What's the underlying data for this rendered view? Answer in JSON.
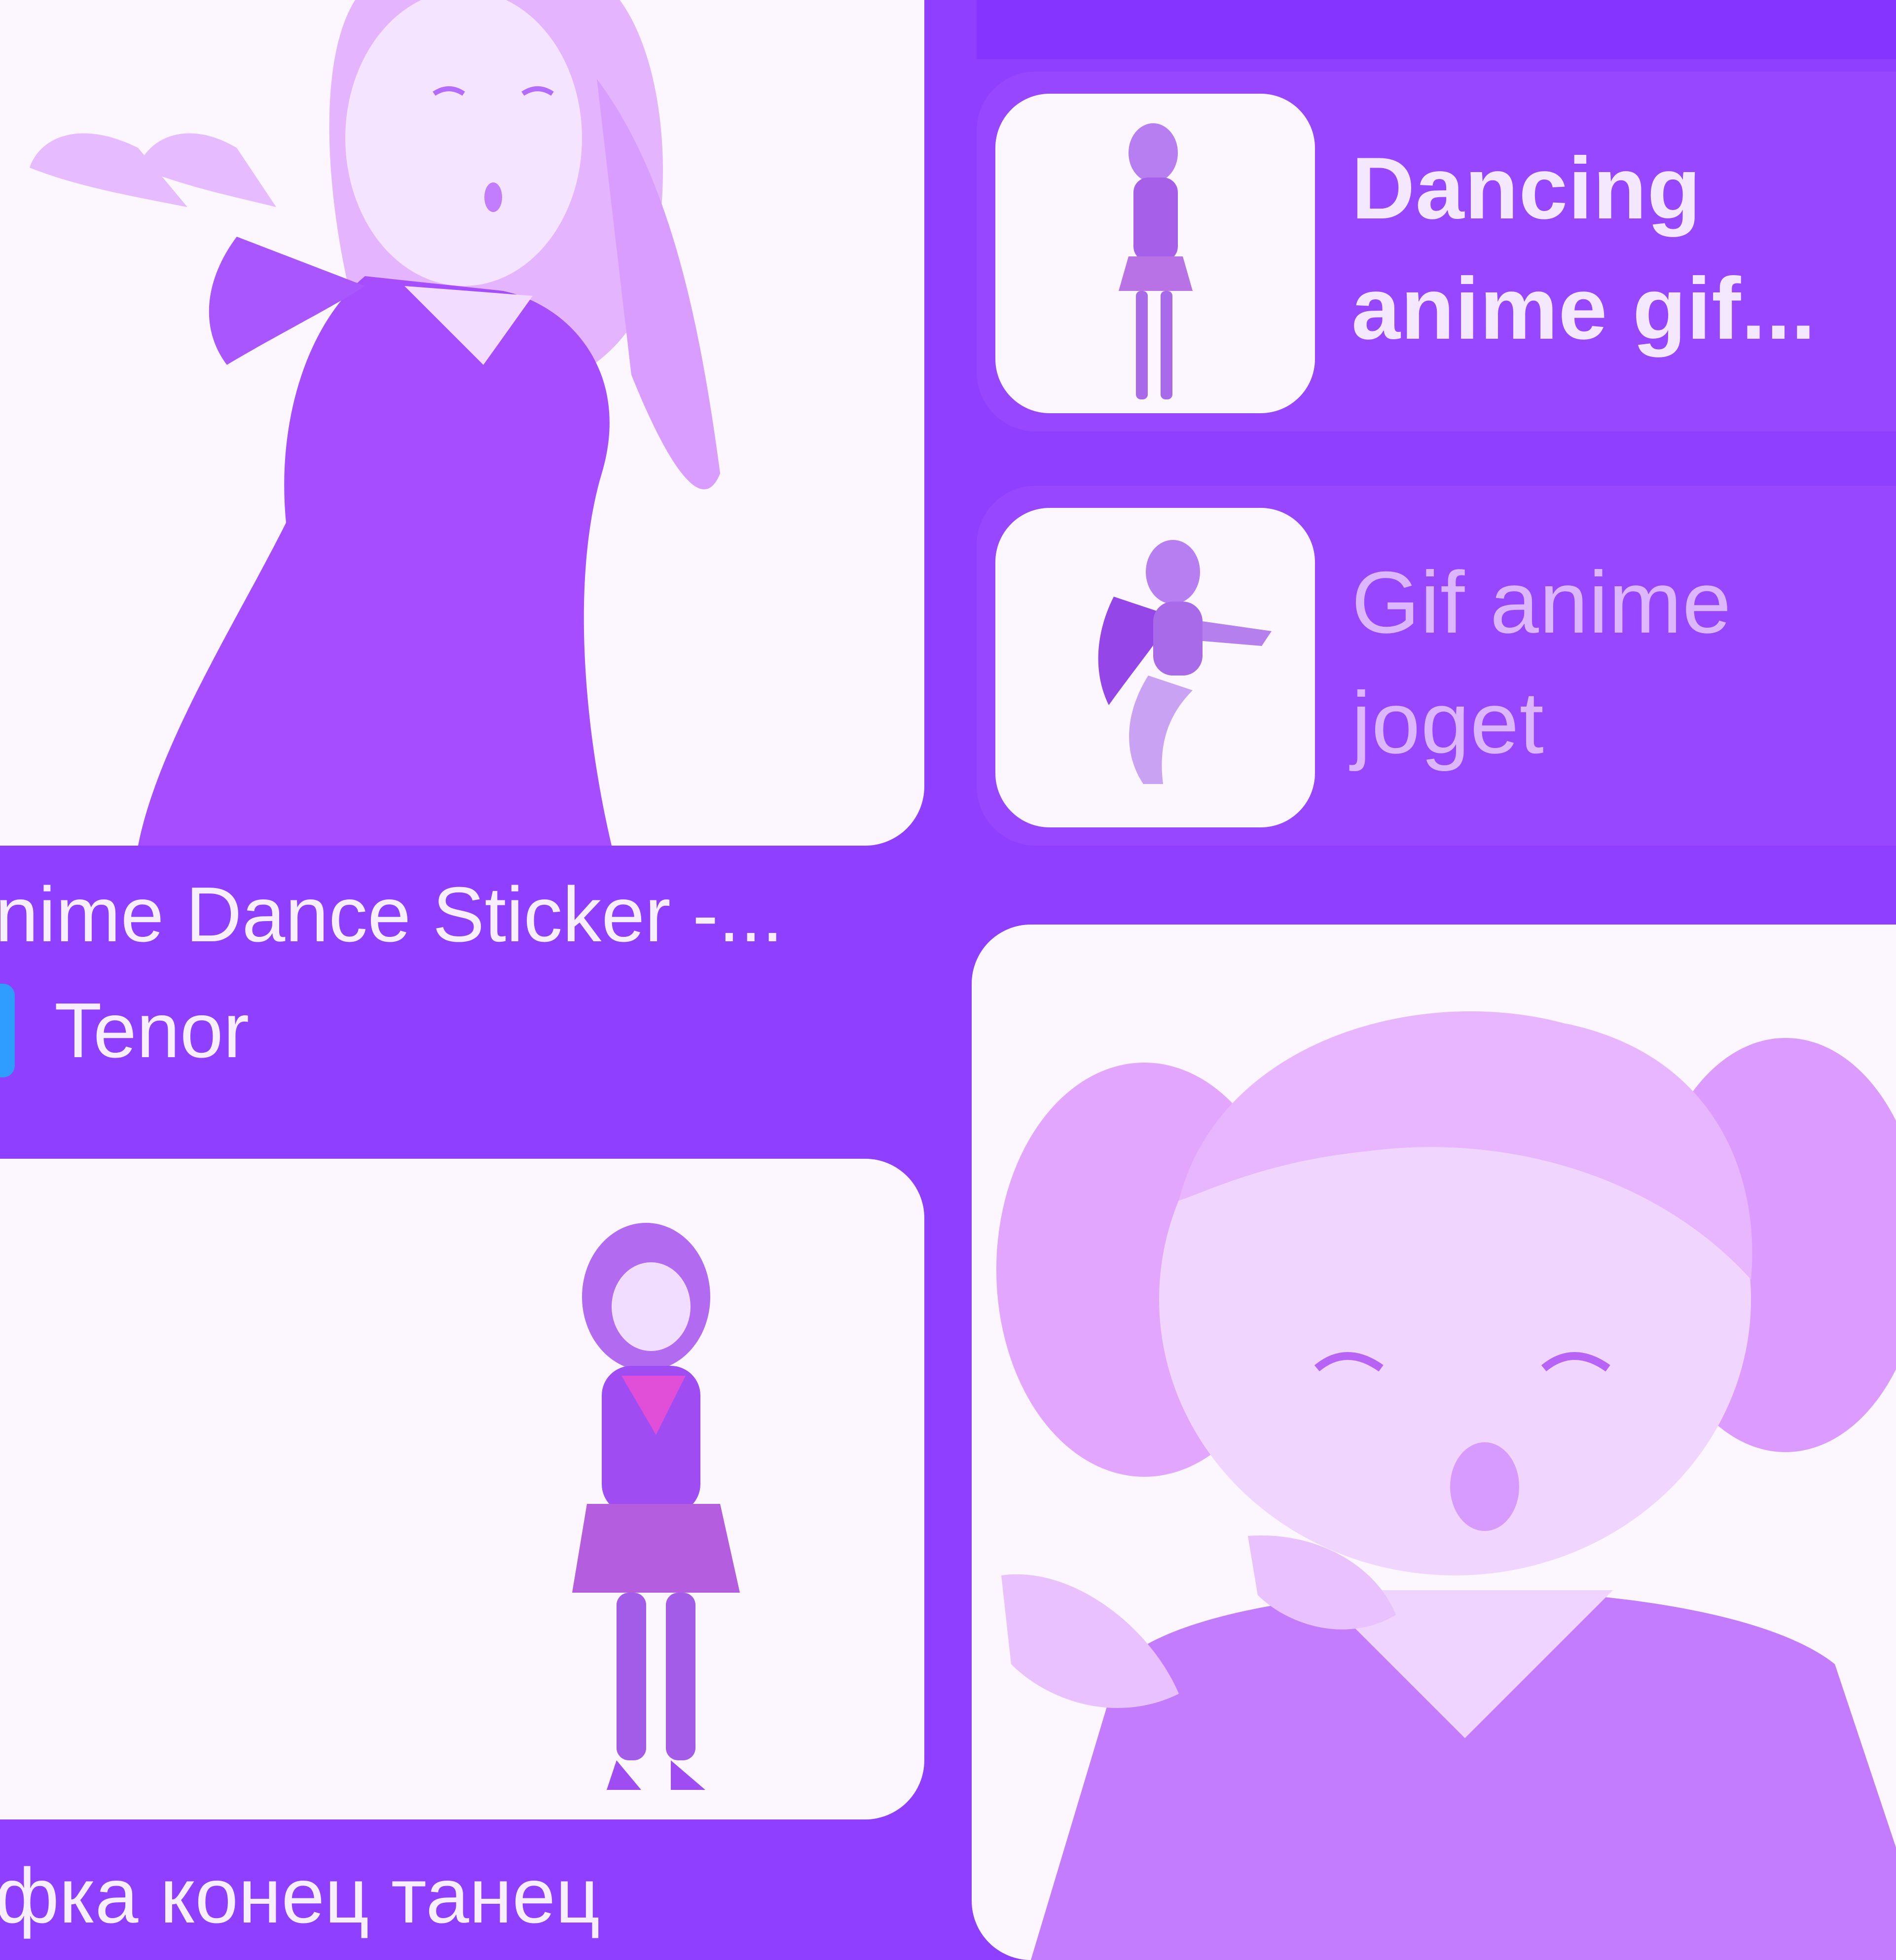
{
  "results": [
    {
      "caption": "nime Dance Sticker -...",
      "source": "Tenor",
      "image_icon": "anime-dancer-image"
    },
    {
      "caption": "фка конец танец",
      "image_icon": "anime-dancer-image"
    },
    {
      "image_icon": "anime-girl-pointing-image"
    }
  ],
  "related": [
    {
      "label_line1": "Dancing",
      "label_line2": "anime gif...",
      "thumb_icon": "anime-dancer-thumbnail"
    },
    {
      "label_line1": "Gif anime",
      "label_line2": "joget",
      "thumb_icon": "anime-jumping-thumbnail"
    }
  ],
  "colors": {
    "background": "#8f3fff",
    "tile": "#fbf6ff",
    "accent_source_icon": "#2f9cff"
  }
}
